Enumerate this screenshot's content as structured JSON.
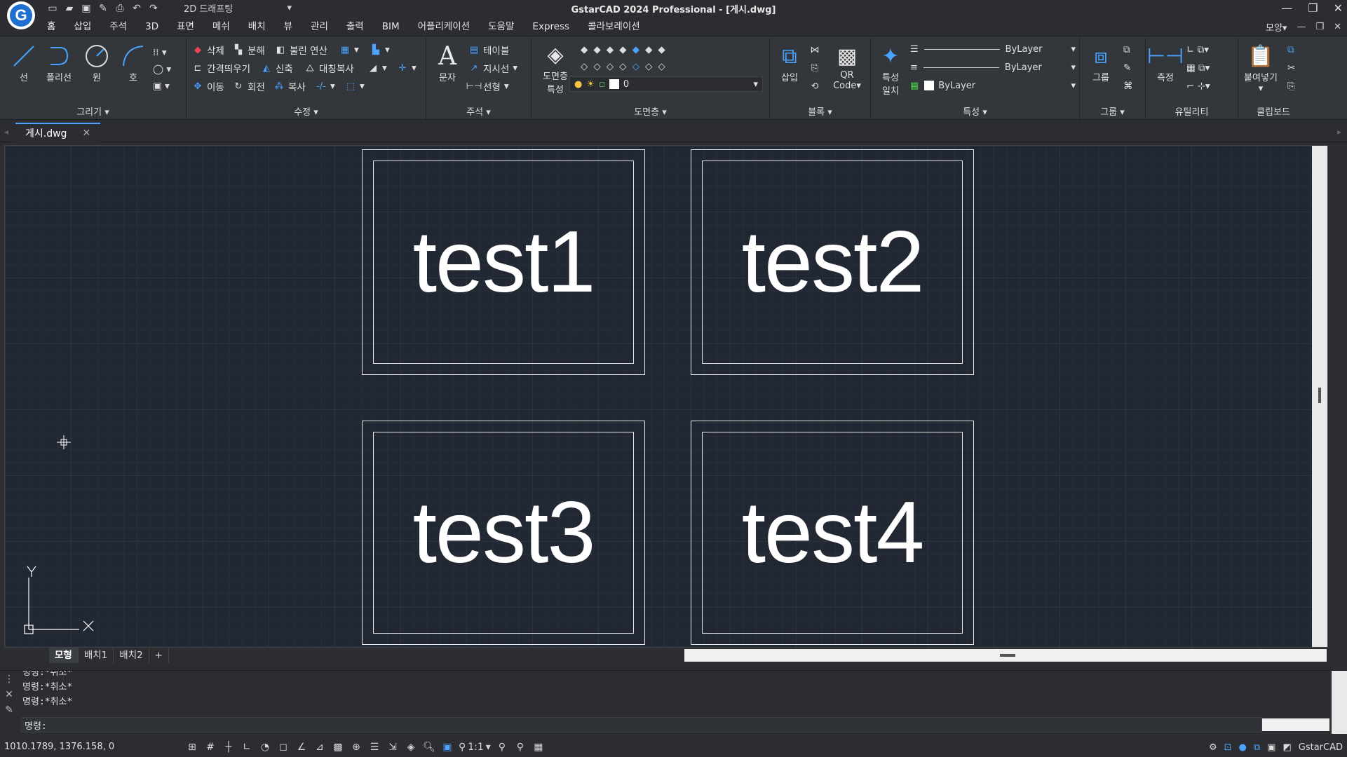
{
  "window": {
    "title": "GstarCAD 2024 Professional - [게시.dwg]",
    "workspace": "2D 드래프팅"
  },
  "menu": [
    "홈",
    "삽입",
    "주석",
    "3D",
    "표면",
    "메쉬",
    "배치",
    "뷰",
    "관리",
    "출력",
    "BIM",
    "어플리케이션",
    "도움말",
    "Express",
    "콜라보레이션"
  ],
  "menu_right": {
    "style_label": "모양"
  },
  "ribbon": {
    "draw": {
      "label": "그리기",
      "line": "선",
      "polyline": "폴리선",
      "circle": "원",
      "arc": "호"
    },
    "modify": {
      "label": "수정",
      "erase": "삭제",
      "explode": "분해",
      "boolean": "불린 연산",
      "offset": "간격띄우기",
      "stretch": "신축",
      "mirror": "대칭복사",
      "move": "이동",
      "rotate": "회전",
      "copy": "복사"
    },
    "annotation": {
      "label": "주석",
      "text": "문자",
      "table": "테이블",
      "leader": "지시선",
      "linear": "선형"
    },
    "layers": {
      "label": "도면층",
      "properties_line1": "도면층",
      "properties_line2": "특성",
      "current_layer": "0"
    },
    "block": {
      "label": "블록",
      "insert": "삽입",
      "qr_line1": "QR",
      "qr_line2": "Code"
    },
    "properties": {
      "label": "특성",
      "match_line1": "특성",
      "match_line2": "일치",
      "lineweight": "ByLayer",
      "linetype": "ByLayer",
      "color": "ByLayer"
    },
    "group": {
      "label": "그룹",
      "group": "그룹"
    },
    "utilities": {
      "label": "유틸리티",
      "measure": "측정"
    },
    "clipboard": {
      "label": "클립보드",
      "paste": "붙여넣기"
    }
  },
  "doc_tab": {
    "name": "게시.dwg"
  },
  "drawing": {
    "frames": [
      {
        "label": "test1"
      },
      {
        "label": "test2"
      },
      {
        "label": "test3"
      },
      {
        "label": "test4"
      }
    ],
    "ucs_x": "X",
    "ucs_y": "Y"
  },
  "layout_tabs": [
    "모형",
    "배치1",
    "배치2",
    "+"
  ],
  "command": {
    "history": [
      "명령:*취소*",
      "명령:*취소*",
      "명령:*취소*"
    ],
    "prompt": "명령:"
  },
  "status": {
    "coords": "1010.1789, 1376.158, 0",
    "scale": "1:1",
    "app_name": "GstarCAD"
  }
}
